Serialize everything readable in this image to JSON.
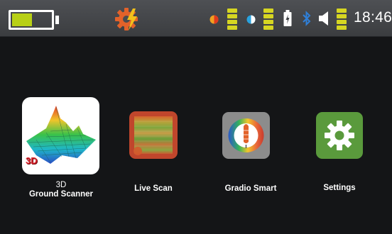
{
  "status_bar": {
    "battery_level": 0.52,
    "battery_color": "#b8d016",
    "time": "18:46",
    "icons": [
      "battery-icon",
      "gear-bolt-icon",
      "color-dot-icon",
      "level-icon",
      "contrast-icon",
      "level-icon",
      "small-battery-icon",
      "bluetooth-icon",
      "speaker-icon",
      "level-icon"
    ]
  },
  "apps": [
    {
      "name": "3d-ground-scanner",
      "label_line1": "3D",
      "label_line2": "Ground Scanner",
      "badge": "3D",
      "icon_bg": "#ffffff"
    },
    {
      "name": "live-scan",
      "label": "Live Scan",
      "icon_bg": "#c0462c"
    },
    {
      "name": "gradio-smart",
      "label": "Gradio Smart",
      "icon_bg": "#8c8c8c"
    },
    {
      "name": "settings",
      "label": "Settings",
      "icon_bg": "#5a9a3c"
    }
  ]
}
